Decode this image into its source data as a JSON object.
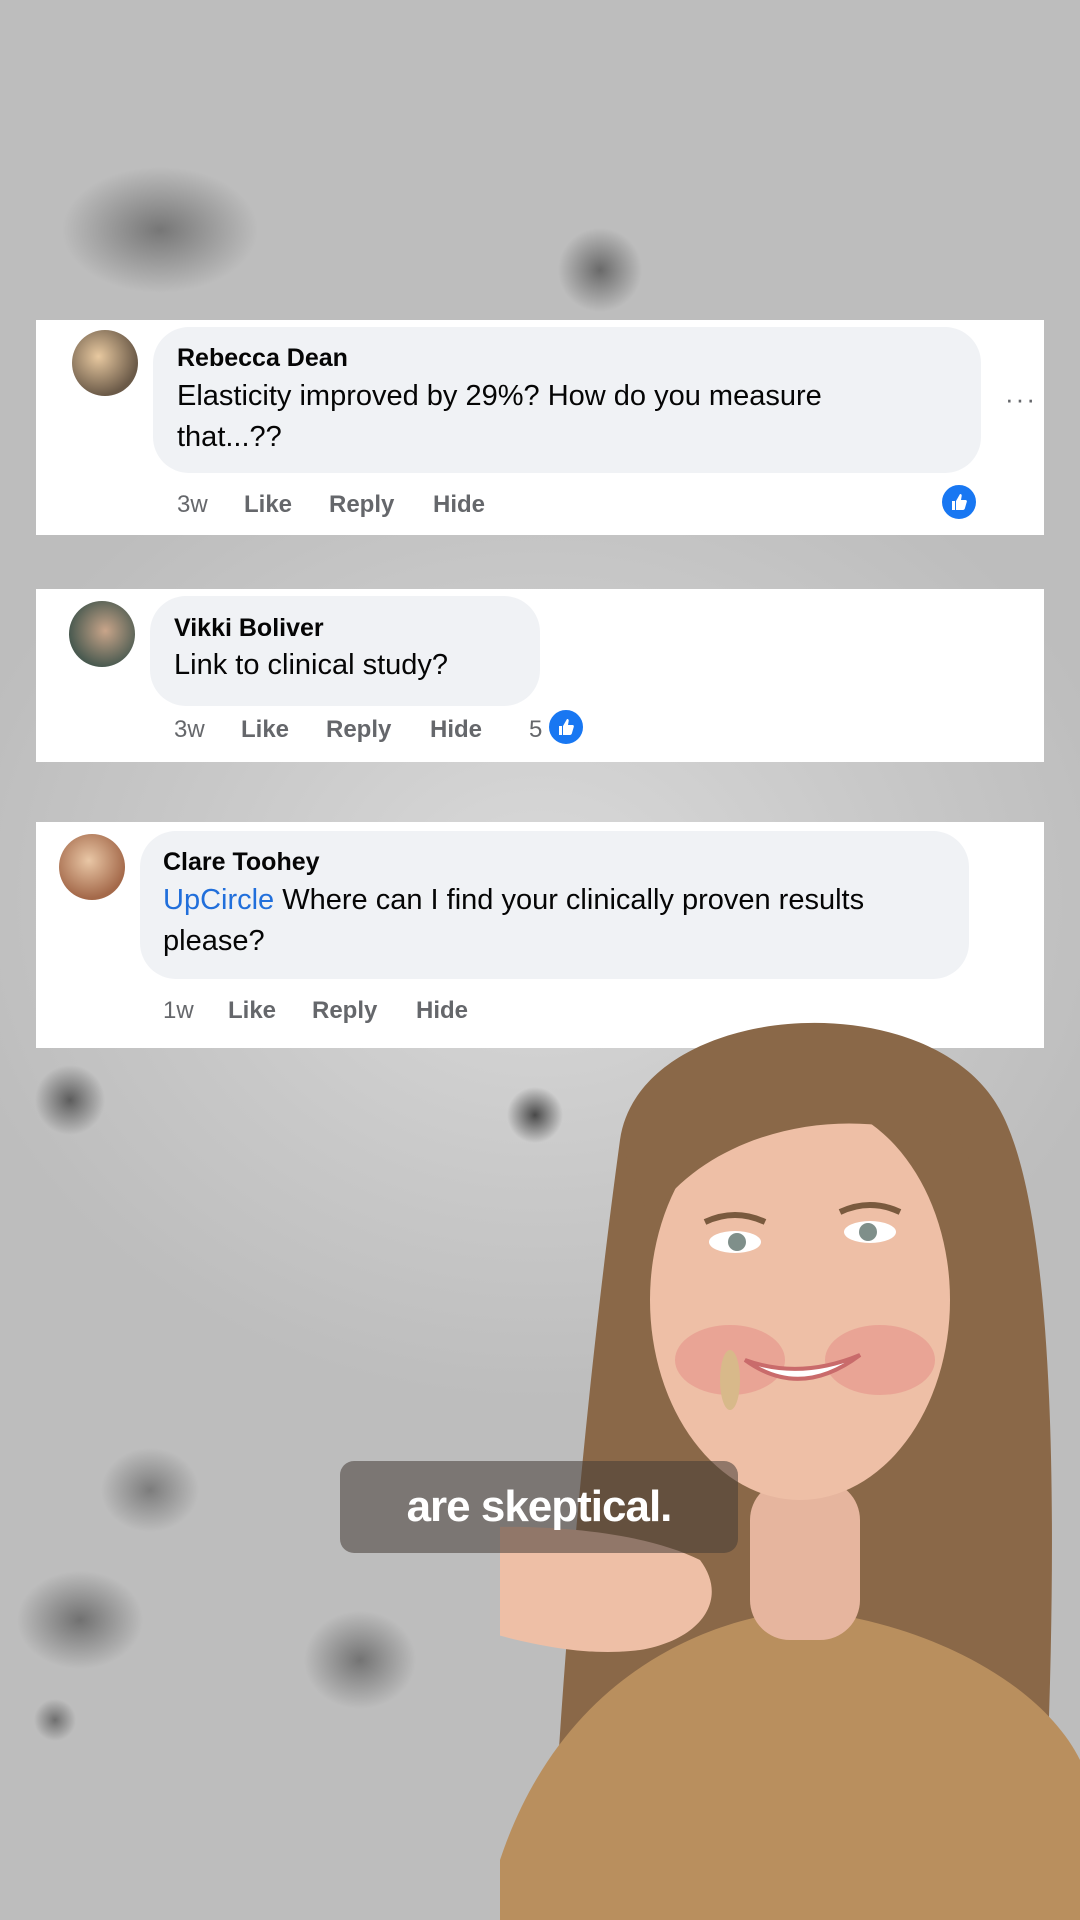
{
  "comments": [
    {
      "author": "Rebecca Dean",
      "text_line1": "Elasticity improved by 29%? How do you measure",
      "text_line2": "that...??",
      "time": "3w",
      "like": "Like",
      "reply": "Reply",
      "hide": "Hide",
      "more": "···",
      "reaction_count": ""
    },
    {
      "author": "Vikki Boliver",
      "text_line1": "Link to clinical study?",
      "time": "3w",
      "like": "Like",
      "reply": "Reply",
      "hide": "Hide",
      "reaction_count": "5"
    },
    {
      "author": "Clare Toohey",
      "mention": "UpCircle",
      "text_line1": " Where can I find your clinically proven results",
      "text_line2": "please?",
      "time": "1w",
      "like": "Like",
      "reply": "Reply",
      "hide": "Hide"
    }
  ],
  "caption": "are skeptical.",
  "colors": {
    "accent": "#1877f2",
    "mention": "#216fdb",
    "bubble": "#f0f2f5",
    "meta_text": "#65676b"
  },
  "icons": [
    "like-reaction-icon",
    "more-options-icon"
  ]
}
